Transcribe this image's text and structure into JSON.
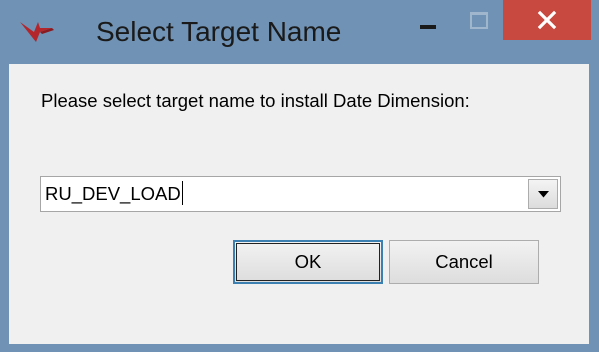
{
  "window": {
    "title": "Select Target Name",
    "title_bar_color": "#6f92b5",
    "close_button_color": "#c7493f"
  },
  "dialog": {
    "prompt": "Please select target name to install Date Dimension:",
    "target_select": {
      "value": "RU_DEV_LOAD"
    },
    "ok_label": "OK",
    "cancel_label": "Cancel"
  },
  "icons": {
    "app": "app-logo-icon",
    "minimize": "minimize-icon",
    "maximize": "maximize-icon",
    "close": "close-icon",
    "dropdown": "chevron-down-icon"
  }
}
